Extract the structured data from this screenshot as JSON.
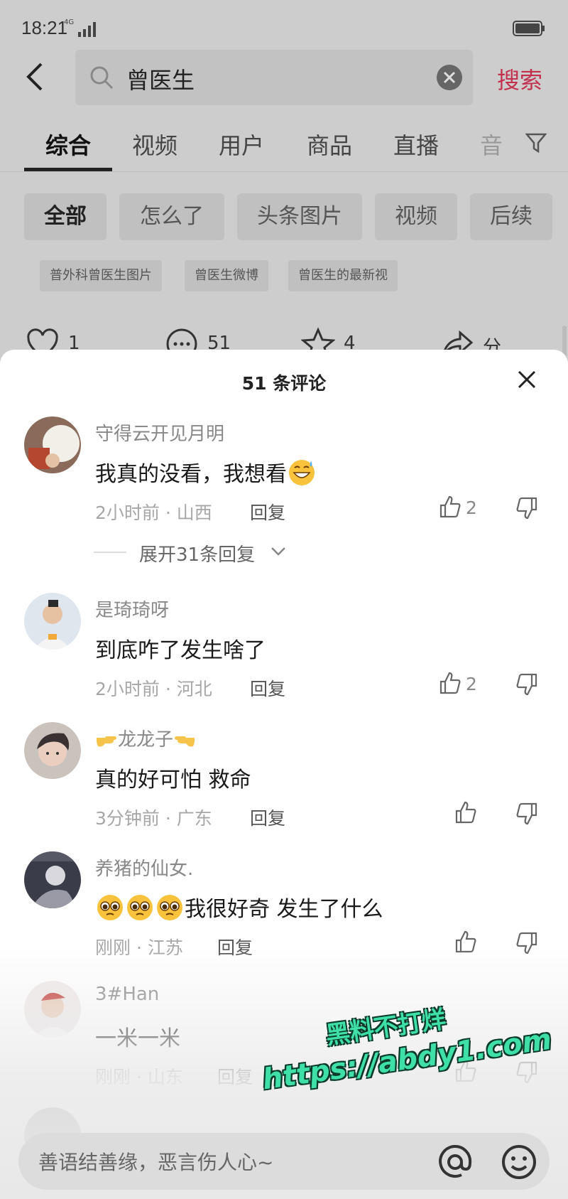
{
  "status": {
    "time": "18:21",
    "network": "4G"
  },
  "search": {
    "query": "曾医生",
    "button": "搜索"
  },
  "tabs": [
    "综合",
    "视频",
    "用户",
    "商品",
    "直播",
    "音"
  ],
  "chips": [
    "全部",
    "怎么了",
    "头条图片",
    "视频",
    "后续"
  ],
  "suggestions": [
    "普外科曾医生图片",
    "曾医生微博",
    "曾医生的最新视"
  ],
  "actions": {
    "likes": "1",
    "comments": "51",
    "favorites": "4",
    "share": "分享"
  },
  "sheet": {
    "title": "51 条评论"
  },
  "comments": [
    {
      "user": "守得云开见月明",
      "text": "我真的没看，我想看",
      "time_loc": "2小时前 · 山西",
      "reply": "回复",
      "likes": "2"
    },
    {
      "user": "是琦琦呀",
      "text": "到底咋了发生啥了",
      "time_loc": "2小时前 · 河北",
      "reply": "回复",
      "likes": "2"
    },
    {
      "user": "龙龙子",
      "text": "真的好可怕  救命",
      "time_loc": "3分钟前 · 广东",
      "reply": "回复",
      "likes": ""
    },
    {
      "user": "养猪的仙女.",
      "text": "我很好奇 发生了什么",
      "time_loc": "刚刚 · 江苏",
      "reply": "回复",
      "likes": ""
    },
    {
      "user": "3#Han",
      "text": "一米一米",
      "time_loc": "刚刚 · 山东",
      "reply": "回复",
      "likes": ""
    }
  ],
  "expand": {
    "label": "展开31条回复"
  },
  "input": {
    "placeholder": "善语结善缘，恶言伤人心~"
  },
  "watermark": {
    "line1": "黑料不打烊",
    "line2": "https://abdy1.com"
  },
  "colors": {
    "accent": "#c2304e",
    "sheet_bg": "#ffffff",
    "dim_bg": "#cdcdcd"
  }
}
